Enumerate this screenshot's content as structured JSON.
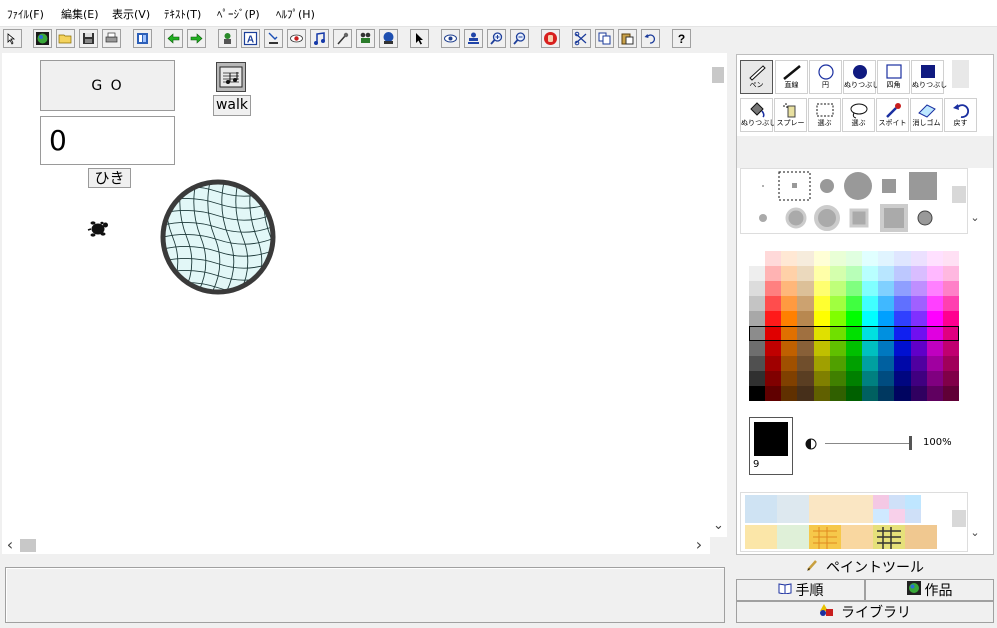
{
  "menu": [
    "ﾌｧｲﾙ(F)",
    "編集(E)",
    "表示(V)",
    "ﾃｷｽﾄ(T)",
    "ﾍﾟｰｼﾞ(P)",
    "ﾍﾙﾌﾟ(H)"
  ],
  "stage": {
    "go_label": "G O",
    "counter_value": "0",
    "counter_unit": "ひき",
    "walk_label": "walk"
  },
  "scroll": {
    "left": "‹",
    "right": "›",
    "down": "⌄"
  },
  "tools_row1": [
    "ペン",
    "直線",
    "円",
    "ぬりつぶし",
    "四角",
    "ぬりつぶし"
  ],
  "tools_row2": [
    "ぬりつぶし",
    "スプレー",
    "選ぶ",
    "選ぶ",
    "スポイト",
    "消しゴム",
    "戻す"
  ],
  "current_color": {
    "hex": "#000000",
    "size": "9",
    "opacity": "100%"
  },
  "tabs": {
    "paint": "ペイントツール",
    "steps": "手順",
    "works": "作品",
    "library": "ライブラリ"
  },
  "colors": {
    "palette_rows": [
      [
        "#ffffff",
        "#ffd9d9",
        "#ffe8d4",
        "#f6ecdc",
        "#ffffd6",
        "#e9ffd6",
        "#e0ffe0",
        "#e0ffff",
        "#e0f4ff",
        "#dfe6ff",
        "#ece0ff",
        "#ffe0ff",
        "#ffe0f4"
      ],
      [
        "#eeeeee",
        "#ffb3b3",
        "#ffd1a8",
        "#ebd9bd",
        "#ffffa8",
        "#d4ffad",
        "#b8ffb8",
        "#b8ffff",
        "#b8e6ff",
        "#bdc8ff",
        "#d9bdff",
        "#ffb8ff",
        "#ffb8e0"
      ],
      [
        "#dcdcdc",
        "#ff8080",
        "#ffb77a",
        "#dcc098",
        "#ffff70",
        "#bfff7a",
        "#80ff80",
        "#80ffff",
        "#80d0ff",
        "#8f9fff",
        "#bf8fff",
        "#ff80ff",
        "#ff80c8"
      ],
      [
        "#c4c4c4",
        "#ff4d4d",
        "#ff9a40",
        "#cca270",
        "#ffff30",
        "#a0ff40",
        "#40ff40",
        "#40ffff",
        "#40b8ff",
        "#6070ff",
        "#a060ff",
        "#ff40ff",
        "#ff40b0"
      ],
      [
        "#a8a8a8",
        "#ff1a1a",
        "#ff8000",
        "#b88850",
        "#ffff00",
        "#80ff00",
        "#00ff00",
        "#00ffff",
        "#00a0ff",
        "#3040ff",
        "#8030ff",
        "#ff00ff",
        "#ff0090"
      ],
      [
        "#8c8c8c",
        "#e00000",
        "#e07000",
        "#a07040",
        "#e0e000",
        "#70e000",
        "#00e000",
        "#00e0e0",
        "#0090e0",
        "#1020f0",
        "#7010f0",
        "#e000e0",
        "#e00080"
      ],
      [
        "#6e6e6e",
        "#c00000",
        "#c06000",
        "#886038",
        "#c0c000",
        "#60c000",
        "#00c000",
        "#00c0c0",
        "#0078c0",
        "#0010d0",
        "#6000c8",
        "#c000c0",
        "#c00070"
      ],
      [
        "#505050",
        "#a00000",
        "#a05000",
        "#704e2c",
        "#a0a000",
        "#50a000",
        "#00a000",
        "#00a0a0",
        "#0060a0",
        "#0008a8",
        "#5000a0",
        "#a000a0",
        "#a0005a"
      ],
      [
        "#303030",
        "#800000",
        "#804000",
        "#5a3e22",
        "#808000",
        "#408000",
        "#008000",
        "#008080",
        "#004c80",
        "#000680",
        "#400080",
        "#800080",
        "#800048"
      ],
      [
        "#000000",
        "#600000",
        "#603000",
        "#462f1a",
        "#606000",
        "#306000",
        "#006000",
        "#006060",
        "#003860",
        "#000460",
        "#300060",
        "#600060",
        "#600036"
      ]
    ],
    "accent": "#000000"
  }
}
